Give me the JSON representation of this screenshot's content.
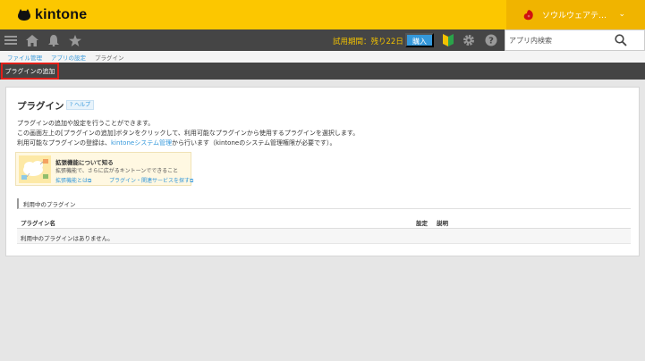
{
  "header": {
    "brand": "kintone",
    "org_name": "ソウルウェアテ…",
    "org_caret": "⌄"
  },
  "nav": {
    "trial_text": "試用期間：残り22日",
    "buy_label": "購入",
    "search_placeholder": "アプリ内検索"
  },
  "breadcrumb": {
    "items": [
      "ファイル管理",
      "アプリの設定",
      "プラグイン"
    ]
  },
  "toolbar": {
    "add_plugin_label": "プラグインの追加"
  },
  "main": {
    "title": "プラグイン",
    "help_label": "? ヘルプ",
    "desc_line1": "プラグインの追加や設定を行うことができます。",
    "desc_line2": "この画面左上の[プラグインの追加]ボタンをクリックして、利用可能なプラグインから使用するプラグインを選択します。",
    "desc_line3_pre": "利用可能なプラグインの登録は、",
    "desc_line3_link": "kintoneシステム管理",
    "desc_line3_post": "から行います（kintoneのシステム管理権限が必要です）。",
    "card": {
      "title": "拡張機能について知る",
      "text": "拡張機能で、さらに広がるキントーンでできること",
      "link1": "拡張機能とは⧉",
      "link2": "プラグイン・関連サービスを探す⧉"
    },
    "section_title": "利用中のプラグイン",
    "table": {
      "headers": [
        "プラグイン名",
        "設定",
        "説明"
      ],
      "empty_message": "利用中のプラグインはありません。"
    }
  },
  "colors": {
    "header_bg": "#fcc700",
    "nav_bg": "#454545",
    "accent": "#3498db",
    "highlight_border": "#e0201a"
  }
}
